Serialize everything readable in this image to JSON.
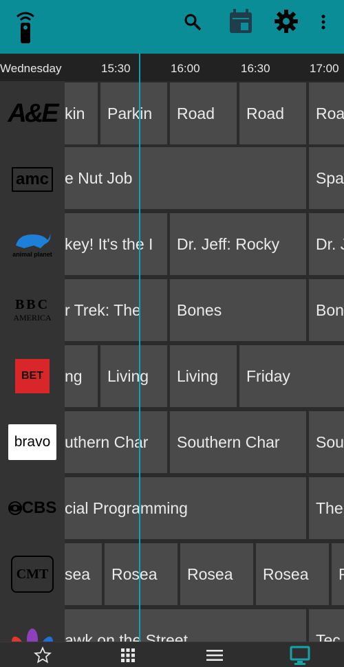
{
  "toolbar": {
    "icons": [
      "remote-icon",
      "search-icon",
      "calendar-icon",
      "gear-icon",
      "more-vert-icon"
    ],
    "accent": "#0a8d96"
  },
  "timeline": {
    "day": "Wednesday",
    "times": [
      "15:30",
      "16:00",
      "16:30",
      "17:00"
    ]
  },
  "channels": [
    {
      "name": "A&E",
      "logo_text": "A&E"
    },
    {
      "name": "AMC",
      "logo_text": "amc"
    },
    {
      "name": "Animal Planet",
      "logo_text": "animal planet"
    },
    {
      "name": "BBC America",
      "logo_text_top": "BBC",
      "logo_text_bottom": "AMERICA"
    },
    {
      "name": "BET",
      "logo_text": "BET"
    },
    {
      "name": "Bravo",
      "logo_text": "bravo"
    },
    {
      "name": "CBS",
      "logo_text": "CBS"
    },
    {
      "name": "CMT",
      "logo_text": "CMT"
    },
    {
      "name": "NBC",
      "logo_text": ""
    }
  ],
  "rows": [
    [
      "kin",
      "Parkin",
      "Road",
      "Road",
      "Roa"
    ],
    [
      "e Nut Job",
      "Spa"
    ],
    [
      "key! It's the I",
      "Dr. Jeff: Rocky",
      "Dr. J"
    ],
    [
      "r Trek: The",
      "Bones",
      "Bon"
    ],
    [
      "ng",
      "Living",
      "Living",
      "Friday"
    ],
    [
      "uthern Char",
      "Southern Char",
      "Sou"
    ],
    [
      "cial Programming",
      "The"
    ],
    [
      "sea",
      "Rosea",
      "Rosea",
      "Rosea",
      "R"
    ],
    [
      "awk on the Street",
      "Tec"
    ]
  ],
  "bottom_nav": [
    "favorites-star-icon",
    "grid-apps-icon",
    "list-menu-icon",
    "tv-guide-icon"
  ],
  "colors": {
    "cell": "#4a4a4a",
    "background": "#2b2b2b",
    "now_line": "#16a2aa",
    "active_nav": "#16a2aa"
  }
}
